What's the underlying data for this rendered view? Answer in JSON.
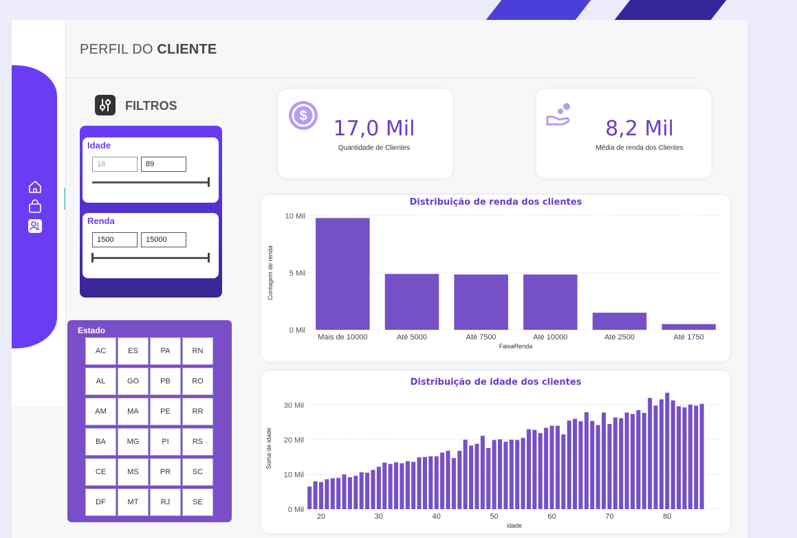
{
  "page": {
    "title_light": "PERFIL DO",
    "title_bold": "CLIENTE"
  },
  "sidebar": {
    "icons": [
      "home-icon",
      "shopping-bag-icon",
      "customer-profile-icon"
    ]
  },
  "filters": {
    "title": "FILTROS",
    "idade": {
      "label": "Idade",
      "min": "18",
      "max": "89",
      "range_fraction": [
        0,
        1
      ]
    },
    "renda": {
      "label": "Renda",
      "min": "1500",
      "max": "15000",
      "range_fraction": [
        0,
        1
      ]
    }
  },
  "estado": {
    "title": "Estado",
    "options": [
      "AC",
      "ES",
      "PA",
      "RN",
      "AL",
      "GO",
      "PB",
      "RO",
      "AM",
      "MA",
      "PE",
      "RR",
      "BA",
      "MG",
      "PI",
      "RS",
      "CE",
      "MS",
      "PR",
      "SC",
      "DF",
      "MT",
      "RJ",
      "SE"
    ]
  },
  "kpis": [
    {
      "value": "17,0 Mil",
      "label": "Quantidade de Clientes",
      "icon": "dollar-coin-icon"
    },
    {
      "value": "8,2 Mil",
      "label": "Média de renda dos Clientes",
      "icon": "hand-money-icon"
    }
  ],
  "colors": {
    "accent": "#6a3df5",
    "bar": "#7650c6",
    "title": "#6a3dc7"
  },
  "chart_data": [
    {
      "type": "bar",
      "title": "Distribuição de renda dos clientes",
      "xlabel": "FaixaRenda",
      "ylabel": "Contagem de renda",
      "categories": [
        "Mais de 10000",
        "Até 5000",
        "Até 7500",
        "Até 10000",
        "Até 2500",
        "Até 1750"
      ],
      "values": [
        9800,
        4900,
        4850,
        4850,
        1500,
        500
      ],
      "ylim": [
        0,
        10000
      ],
      "yticks": [
        0,
        5000,
        10000
      ],
      "ytick_labels": [
        "0 Mil",
        "5 Mil",
        "10 Mil"
      ],
      "grid": true
    },
    {
      "type": "bar",
      "title": "Distribuição de idade dos clientes",
      "xlabel": "idade",
      "ylabel": "Soma de idade",
      "x": [
        18,
        19,
        20,
        21,
        22,
        23,
        24,
        25,
        26,
        27,
        28,
        29,
        30,
        31,
        32,
        33,
        34,
        35,
        36,
        37,
        38,
        39,
        40,
        41,
        42,
        43,
        44,
        45,
        46,
        47,
        48,
        49,
        50,
        51,
        52,
        53,
        54,
        55,
        56,
        57,
        58,
        59,
        60,
        61,
        62,
        63,
        64,
        65,
        66,
        67,
        68,
        69,
        70,
        71,
        72,
        73,
        74,
        75,
        76,
        77,
        78,
        79,
        80,
        81,
        82,
        83,
        84,
        85,
        86,
        87,
        88,
        89
      ],
      "values": [
        6500,
        8000,
        7800,
        8600,
        8900,
        9000,
        10000,
        9200,
        9600,
        10600,
        10500,
        11300,
        12200,
        13400,
        13000,
        13500,
        13200,
        13800,
        13600,
        14900,
        15000,
        15200,
        15200,
        16300,
        16800,
        14700,
        16800,
        20000,
        18300,
        18800,
        21100,
        17600,
        19900,
        20100,
        19400,
        20000,
        19900,
        20500,
        23000,
        22800,
        21900,
        23400,
        24000,
        24000,
        21500,
        25500,
        26000,
        25300,
        27900,
        25400,
        24200,
        27800,
        24500,
        26400,
        26200,
        27800,
        27400,
        28500,
        27700,
        32000,
        29800,
        31600,
        33500,
        31300,
        29600,
        29300,
        30100,
        29800,
        30300
      ],
      "xticks": [
        20,
        30,
        40,
        50,
        60,
        70,
        80
      ],
      "ylim": [
        0,
        35000
      ],
      "yticks": [
        0,
        10000,
        20000,
        30000
      ],
      "ytick_labels": [
        "0 Mil",
        "10 Mil",
        "20 Mil",
        "30 Mil"
      ],
      "grid": true
    }
  ]
}
